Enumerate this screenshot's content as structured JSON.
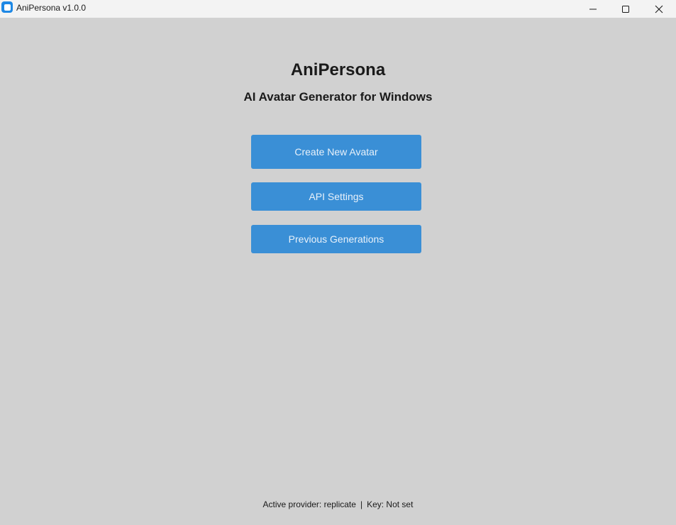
{
  "window": {
    "title": "AniPersona v1.0.0"
  },
  "main": {
    "title": "AniPersona",
    "subtitle": "AI Avatar Generator for Windows",
    "buttons": {
      "create": "Create New Avatar",
      "api_settings": "API Settings",
      "previous": "Previous Generations"
    }
  },
  "status": {
    "provider": "Active provider: replicate",
    "separator": "|",
    "key": "Key: Not set"
  },
  "colors": {
    "background": "#d1d1d1",
    "titlebar": "#f3f3f3",
    "button": "#3a8fd6",
    "button_text": "#e8f1fa",
    "app_icon": "#1e88e5"
  },
  "icons": {
    "app": "app-icon",
    "minimize": "minimize-icon",
    "maximize": "maximize-icon",
    "close": "close-icon"
  }
}
